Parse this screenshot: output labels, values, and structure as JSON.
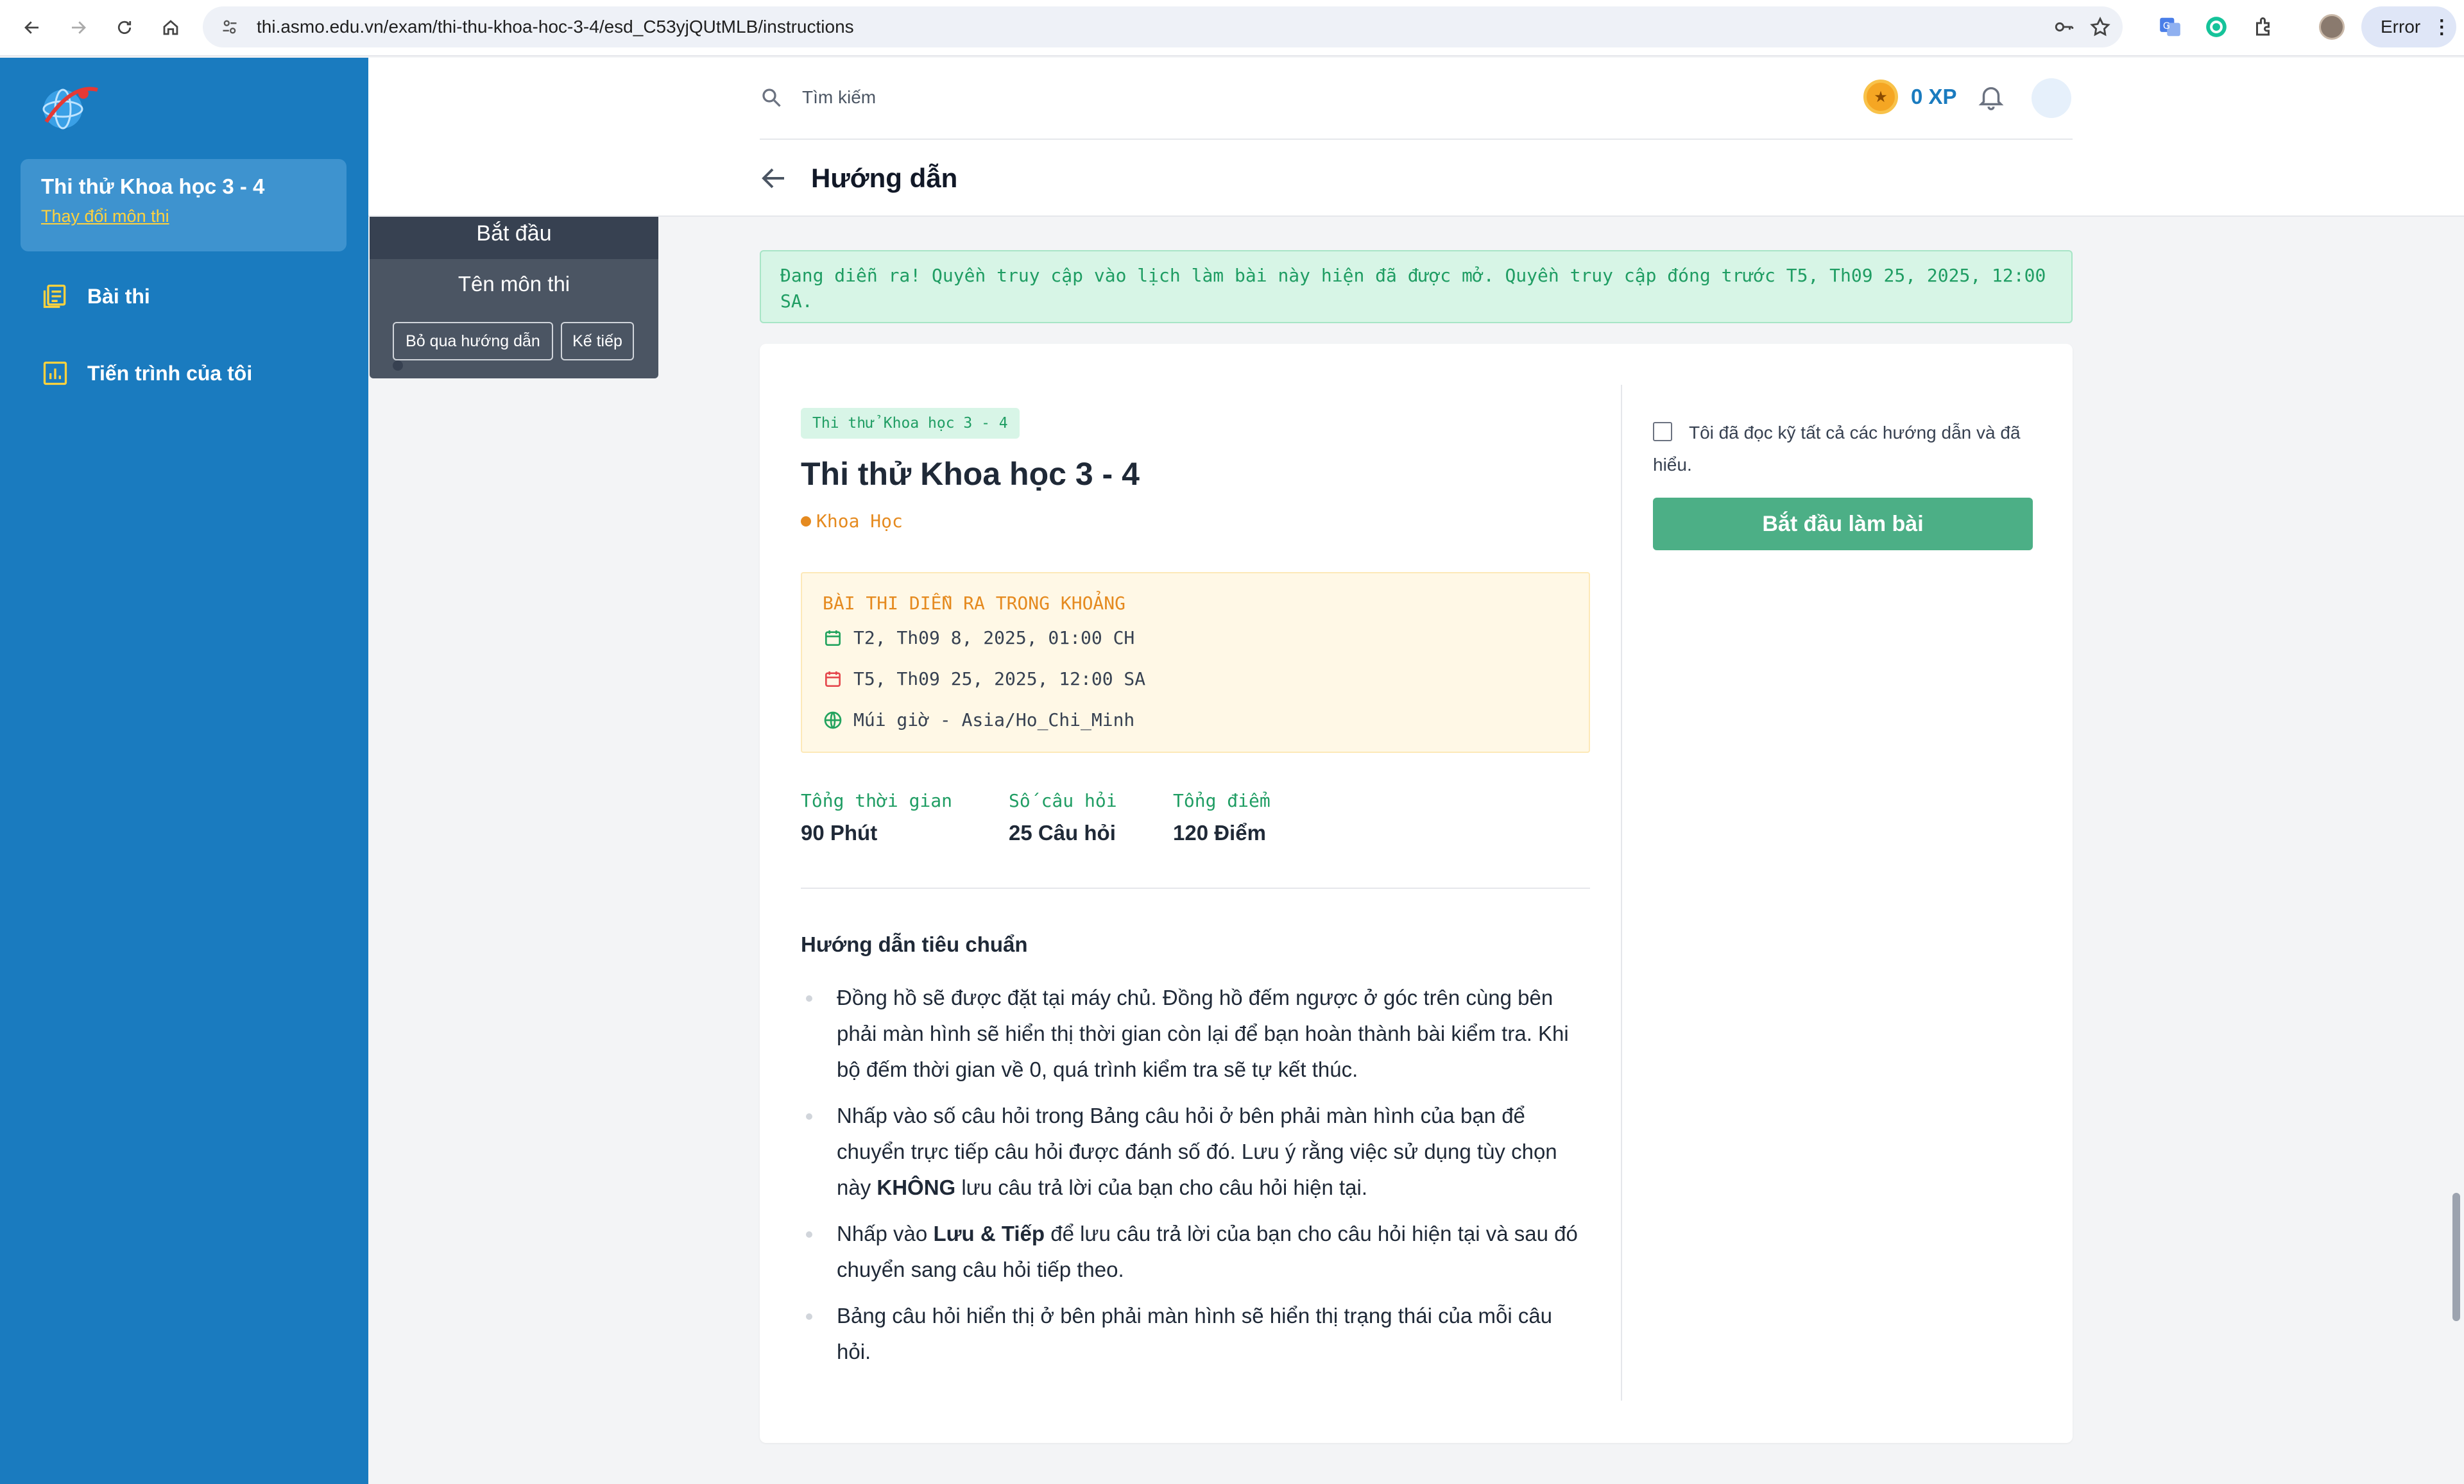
{
  "browser": {
    "url": "thi.asmo.edu.vn/exam/thi-thu-khoa-hoc-3-4/esd_C53yjQUtMLB/instructions",
    "profile_status": "Error"
  },
  "sidebar": {
    "course_title": "Thi thử Khoa học 3 - 4",
    "change_link": "Thay đổi môn thi",
    "items": [
      {
        "label": "Bài thi",
        "icon": "exam-list-icon"
      },
      {
        "label": "Tiến trình của tôi",
        "icon": "chart-icon"
      }
    ]
  },
  "header": {
    "search_placeholder": "Tìm kiếm",
    "xp": "0 XP",
    "page_title": "Hướng dẫn"
  },
  "tour": {
    "title": "Bắt đầu",
    "body": "Tên môn thi",
    "skip_label": "Bỏ qua hướng dẫn",
    "next_label": "Kế tiếp"
  },
  "notice": "Đang diễn ra! Quyền truy cập vào lịch làm bài này hiện đã được mở. Quyền truy cập đóng trước T5, Th09 25, 2025, 12:00 SA.",
  "exam": {
    "tag": "Thi thử Khoa học 3 - 4",
    "title": "Thi thử Khoa học 3 - 4",
    "subject": "Khoa Học",
    "schedule": {
      "heading": "BÀI THI DIỄN RA TRONG KHOẢNG",
      "start": "T2, Th09 8, 2025, 01:00 CH",
      "end": "T5, Th09 25, 2025, 12:00 SA",
      "timezone": "Múi giờ - Asia/Ho_Chi_Minh"
    },
    "stats": [
      {
        "label": "Tổng thời gian",
        "value": "90 Phút"
      },
      {
        "label": "Số câu hỏi",
        "value": "25 Câu hỏi"
      },
      {
        "label": "Tổng điểm",
        "value": "120 Điểm"
      }
    ],
    "guide_heading": "Hướng dẫn tiêu chuẩn",
    "guide": [
      {
        "pre": "Đồng hồ sẽ được đặt tại máy chủ. Đồng hồ đếm ngược ở góc trên cùng bên phải màn hình sẽ hiển thị thời gian còn lại để bạn hoàn thành bài kiểm tra. Khi bộ đếm thời gian về 0, quá trình kiểm tra sẽ tự kết thúc.",
        "bold": "",
        "post": ""
      },
      {
        "pre": "Nhấp vào số câu hỏi trong Bảng câu hỏi ở bên phải màn hình của bạn để chuyển trực tiếp câu hỏi được đánh số đó. Lưu ý rằng việc sử dụng tùy chọn này ",
        "bold": "KHÔNG",
        "post": " lưu câu trả lời của bạn cho câu hỏi hiện tại."
      },
      {
        "pre": "Nhấp vào ",
        "bold": "Lưu & Tiếp",
        "post": " để lưu câu trả lời của bạn cho câu hỏi hiện tại và sau đó chuyển sang câu hỏi tiếp theo."
      },
      {
        "pre": "Bảng câu hỏi hiển thị ở bên phải màn hình sẽ hiển thị trạng thái của mỗi câu hỏi.",
        "bold": "",
        "post": ""
      }
    ]
  },
  "side_panel": {
    "agree_text": "Tôi đã đọc kỹ tất cả các hướng dẫn và đã hiểu.",
    "start_button": "Bắt đầu làm bài"
  },
  "colors": {
    "sidebar": "#1a7bbf",
    "accent_green": "#4caf86",
    "notice_bg": "#d7f5e6",
    "warning_orange": "#e58a1f"
  }
}
